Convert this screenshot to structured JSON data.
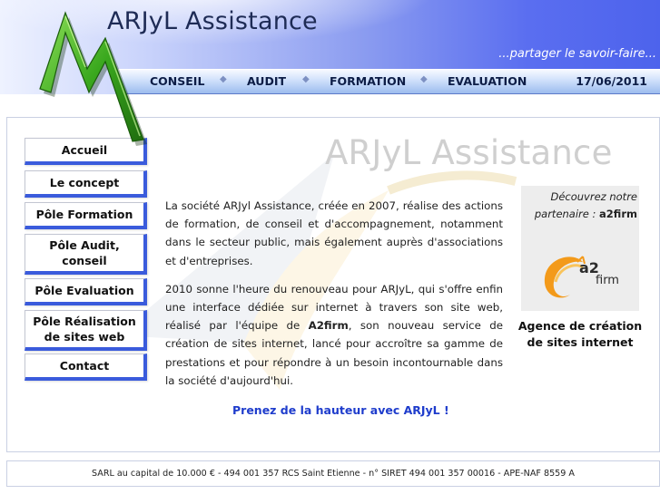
{
  "header": {
    "title": "ARJyL Assistance",
    "tagline": "...partager le savoir-faire...",
    "nav": [
      "CONSEIL",
      "AUDIT",
      "FORMATION",
      "EVALUATION"
    ],
    "date": "17/06/2011"
  },
  "watermark": "ARJyL Assistance",
  "menu": [
    "Accueil",
    "Le concept",
    "Pôle Formation",
    "Pôle Audit, conseil",
    "Pôle Evaluation",
    "Pôle Réalisation de sites web",
    "Contact"
  ],
  "content": {
    "p1": "La société ARJyl Assistance, créée en 2007, réalise des actions de formation, de conseil et d'accompagnement, notamment dans le secteur public, mais également auprès d'associations et d'entreprises.",
    "p2_before": "2010 sonne l'heure du renouveau pour ARJyL, qui s'offre enfin une interface dédiée sur internet à travers son site web, réalisé par l'équipe de ",
    "p2_brand": "A2firm",
    "p2_after": ", son nouveau service de création de sites internet, lancé pour accroître sa gamme de prestations et pour répondre à un besoin incontournable dans la société d'aujourd'hui.",
    "slogan": "Prenez de la hauteur avec ARJyL !"
  },
  "partner": {
    "line1": "Découvrez notre",
    "line2": "partenaire : ",
    "name": "a2firm",
    "logo_a2": "a2",
    "logo_firm": "firm",
    "agency": "Agence de création de sites internet"
  },
  "footer": "SARL au capital de 10.000 € - 494 001 357 RCS Saint Etienne - n° SIRET 494 001 357 00016 - APE-NAF 8559 A",
  "colors": {
    "menu_accent": "#3a5bdc",
    "slogan": "#1e3ccc",
    "logo_green": "#3aa81e",
    "a2_orange": "#f39a1a"
  }
}
